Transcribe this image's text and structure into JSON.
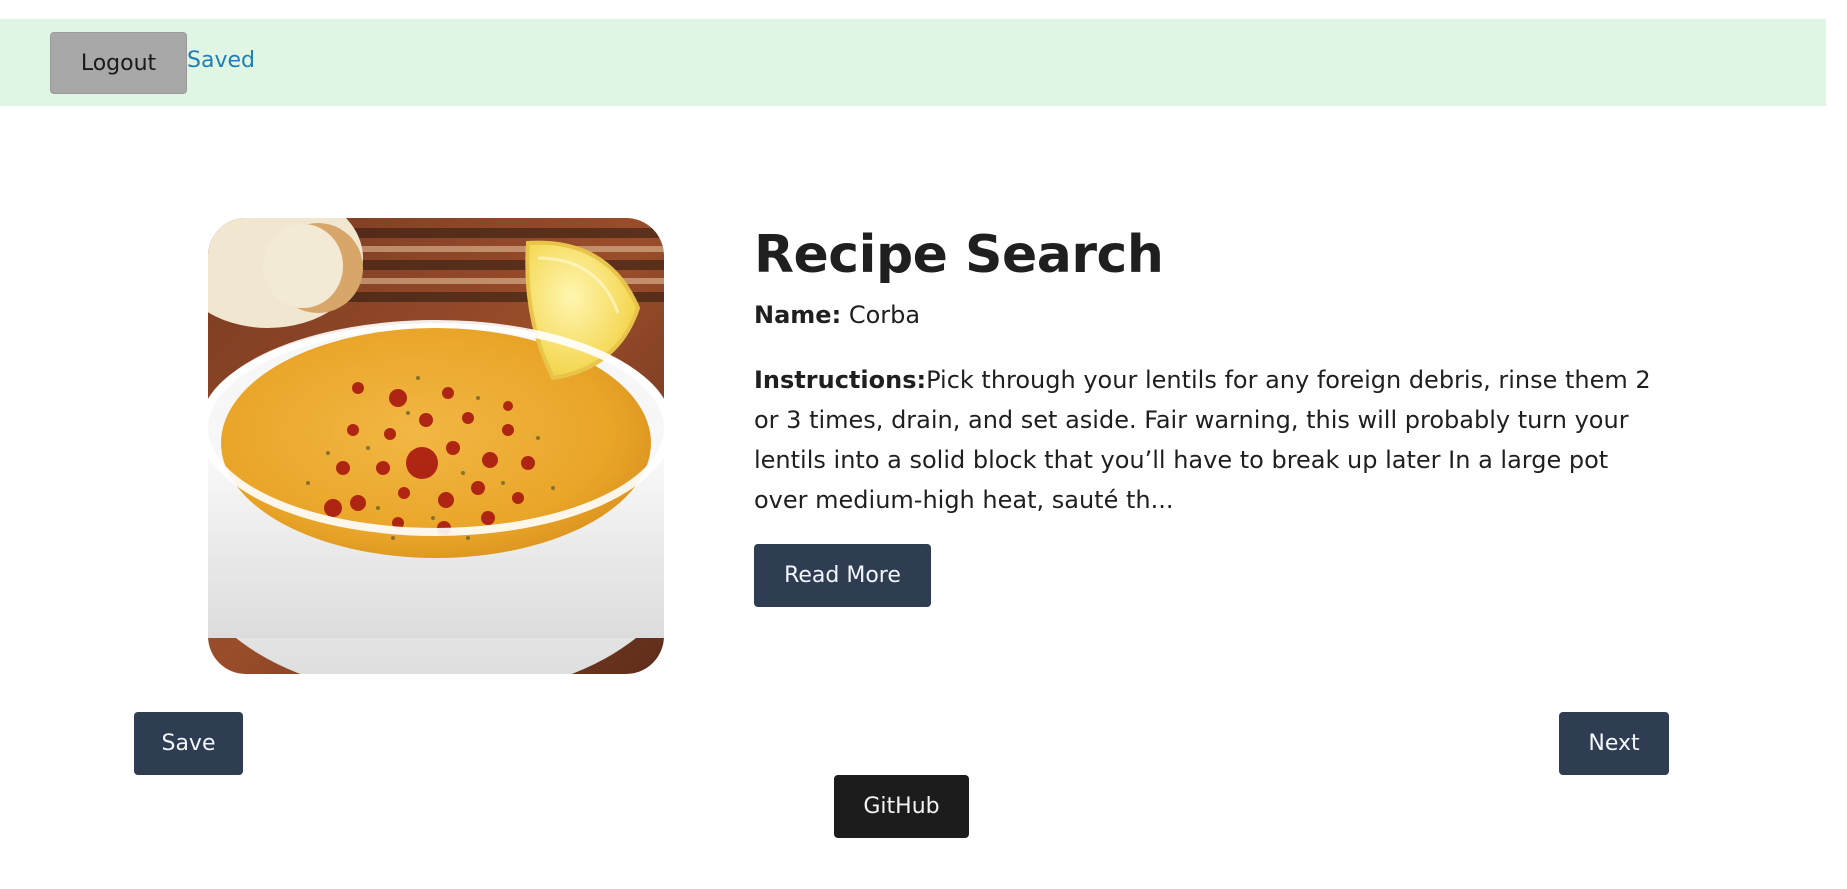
{
  "header": {
    "logout_label": "Logout",
    "saved_link": "Saved"
  },
  "main": {
    "title": "Recipe Search",
    "name_label": "Name:",
    "name_value": "Corba",
    "instructions_label": "Instructions:",
    "instructions_text": "Pick through your lentils for any foreign debris, rinse them 2 or 3 times, drain, and set aside. Fair warning, this will probably turn your lentils into a solid block that you’ll have to break up later In a large pot over medium-high heat, sauté th...",
    "read_more_label": "Read More",
    "image_alt": "Corba"
  },
  "footer": {
    "save_label": "Save",
    "next_label": "Next",
    "github_label": "GitHub"
  },
  "colors": {
    "header_bg": "#e0f5e3",
    "logout_bg": "#a8a8a8",
    "link": "#1e7fb8",
    "primary_button": "#2e3d51",
    "github_button": "#1c1c1c"
  }
}
